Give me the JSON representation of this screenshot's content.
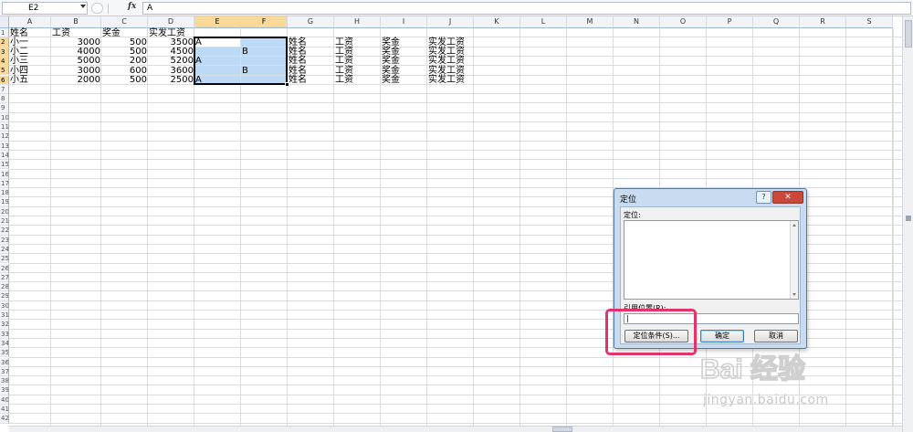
{
  "formula_bar": {
    "name_box": "E2",
    "fx_label": "fx",
    "content": "A"
  },
  "columns": [
    "A",
    "B",
    "C",
    "D",
    "E",
    "F",
    "G",
    "H",
    "I",
    "J",
    "K",
    "L",
    "M",
    "N",
    "O",
    "P",
    "Q",
    "R",
    "S"
  ],
  "rows_count": 42,
  "selected_columns": [
    "E",
    "F"
  ],
  "selected_rows": [
    2,
    3,
    4,
    5,
    6
  ],
  "table": {
    "header": [
      "姓名",
      "工资",
      "奖金",
      "实发工资"
    ],
    "rows": [
      {
        "name": "小一",
        "salary": "3000",
        "bonus": "500",
        "total": "3500",
        "e": "A",
        "f": ""
      },
      {
        "name": "小二",
        "salary": "4000",
        "bonus": "500",
        "total": "4500",
        "e": "",
        "f": "B"
      },
      {
        "name": "小三",
        "salary": "5000",
        "bonus": "200",
        "total": "5200",
        "e": "A",
        "f": ""
      },
      {
        "name": "小四",
        "salary": "3000",
        "bonus": "600",
        "total": "3600",
        "e": "",
        "f": "B"
      },
      {
        "name": "小五",
        "salary": "2000",
        "bonus": "500",
        "total": "2500",
        "e": "A",
        "f": ""
      }
    ],
    "repeated_headers": [
      "姓名",
      "工资",
      "奖金",
      "实发工资"
    ]
  },
  "dialog": {
    "title": "定位",
    "help_label": "?",
    "close_label": "✕",
    "goto_label": "定位:",
    "reference_label": "引用位置(R):",
    "reference_value": "|",
    "special_button": "定位条件(S)...",
    "ok_button": "确定",
    "cancel_button": "取消"
  },
  "watermark": {
    "logo_text": "Bai 经验",
    "url": "jingyan.baidu.com"
  },
  "colors": {
    "selection_fill": "#bcd9f5",
    "header_selected": "#f9d99a",
    "highlight_border": "#e4336b",
    "dialog_frame": "#c8dbf0"
  }
}
